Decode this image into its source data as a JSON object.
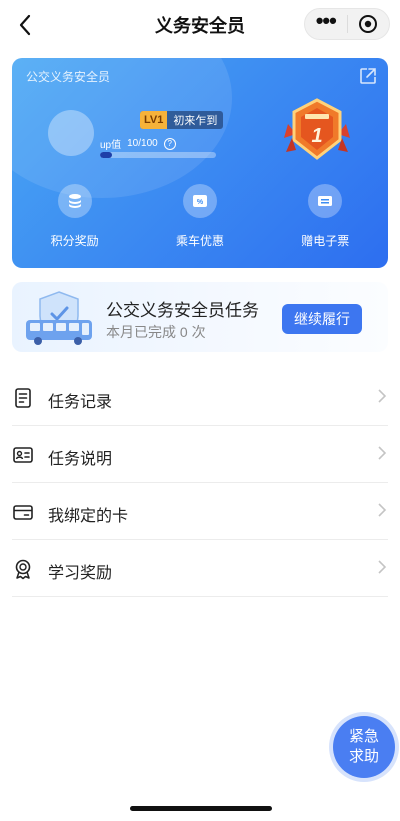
{
  "header": {
    "title": "义务安全员"
  },
  "card": {
    "title": "公交义务安全员",
    "level_tag": "LV1",
    "level_name": "初来乍到",
    "up_label": "up值",
    "up_value": "10/100",
    "up_progress": 0.1,
    "benefits": [
      {
        "label": "积分奖励",
        "icon": "coins-icon"
      },
      {
        "label": "乘车优惠",
        "icon": "coupon-icon"
      },
      {
        "label": "赠电子票",
        "icon": "ticket-icon"
      }
    ]
  },
  "task": {
    "title": "公交义务安全员任务",
    "subtitle": "本月已完成 0 次",
    "button": "继续履行"
  },
  "menu": {
    "items": [
      {
        "label": "任务记录",
        "icon": "task-record-icon"
      },
      {
        "label": "任务说明",
        "icon": "id-card-icon"
      },
      {
        "label": "我绑定的卡",
        "icon": "bank-card-icon"
      },
      {
        "label": "学习奖励",
        "icon": "medal-icon"
      }
    ]
  },
  "sos": {
    "line1": "紧急",
    "line2": "求助"
  },
  "colors": {
    "primary": "#3d76f0",
    "card_start": "#4aa8f4",
    "card_end": "#2d6ef0",
    "badge": "#f07a2a"
  }
}
